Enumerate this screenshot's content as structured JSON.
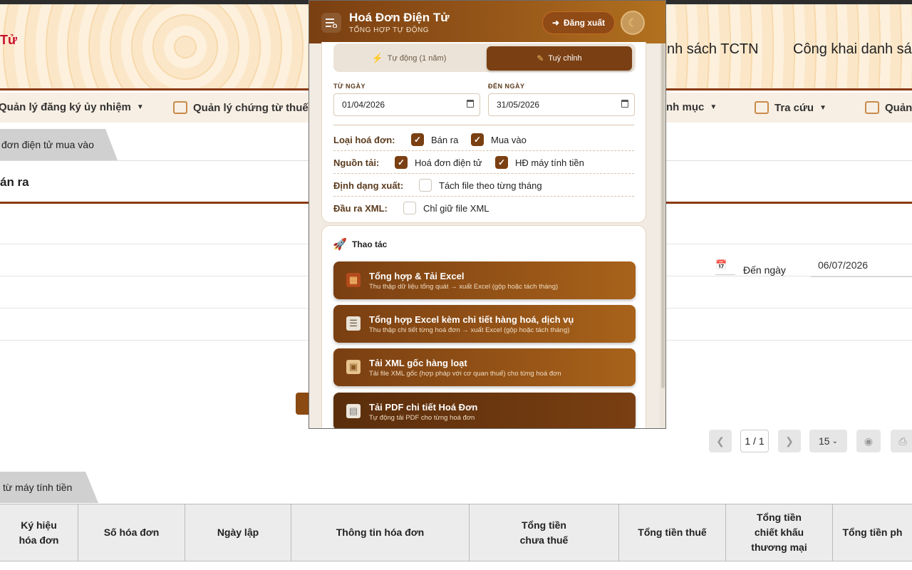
{
  "site": {
    "logo_text": "Tử",
    "header_links": [
      "nh sách TCTN",
      "Công khai danh sác"
    ],
    "nav": [
      {
        "label": "Quản lý đăng ký ủy nhiệm",
        "has_icon": false
      },
      {
        "label": "Quản lý chứng từ thuế th",
        "has_icon": true
      },
      {
        "label": "nh mục",
        "has_icon": false
      },
      {
        "label": "Tra cứu",
        "has_icon": true
      },
      {
        "label": "Quản",
        "has_icon": true
      }
    ],
    "tab_buy": "đơn điện tử mua vào",
    "section_title": "án ra",
    "to_date_label": "Đến ngày",
    "to_date_value": "06/07/2026",
    "pager": {
      "current": "1 / 1",
      "page_size": "15"
    },
    "tab_cash_register": "từ máy tính tiền",
    "table_headers": [
      "Ký hiệu\nhóa đơn",
      "Số hóa đơn",
      "Ngày lập",
      "Thông tin hóa đơn",
      "Tổng tiền\nchưa thuế",
      "Tổng tiền thuế",
      "Tổng tiền\nchiết khấu\nthương mại",
      "Tổng tiền ph"
    ]
  },
  "popup": {
    "title": "Hoá Đơn Điện Tử",
    "subtitle": "TỔNG HỢP TỰ ĐỘNG",
    "logout_label": "Đăng xuất",
    "mode_auto": "Tự động (1 năm)",
    "mode_custom": "Tuỳ chỉnh",
    "from_label": "TỪ NGÀY",
    "from_value": "01/04/2026",
    "to_label": "ĐẾN NGÀY",
    "to_value": "31/05/2026",
    "options": {
      "invoice_type_label": "Loại hoá đơn:",
      "sell_label": "Bán ra",
      "buy_label": "Mua vào",
      "source_label": "Nguồn tải:",
      "einvoice_label": "Hoá đơn điện tử",
      "cash_register_label": "HĐ máy tính tiền",
      "format_label": "Định dạng xuất:",
      "split_month_label": "Tách file theo từng tháng",
      "xml_label": "Đầu ra XML:",
      "xml_only_label": "Chỉ giữ file XML"
    },
    "actions_title": "Thao tác",
    "actions": [
      {
        "title": "Tổng hợp & Tải Excel",
        "desc": "Thu thập dữ liệu tổng quát → xuất Excel (gộp hoặc tách tháng)",
        "icon": "excel-icon"
      },
      {
        "title": "Tổng hợp Excel kèm chi tiết hàng hoá, dịch vụ",
        "desc": "Thu thập chi tiết từng hoá đơn → xuất Excel (gộp hoặc tách tháng)",
        "icon": "clipboard-icon"
      },
      {
        "title": "Tải XML gốc hàng loạt",
        "desc": "Tải file XML gốc (hợp pháp với cơ quan thuế) cho từng hoá đơn",
        "icon": "folder-icon"
      },
      {
        "title": "Tải PDF chi tiết Hoá Đơn",
        "desc": "Tự động tải PDF cho từng hoá đơn",
        "icon": "document-icon"
      }
    ],
    "colors": {
      "brand_dark": "#7a3f12",
      "brand_light": "#b1711f",
      "panel_bg": "#f1ebe3"
    }
  }
}
